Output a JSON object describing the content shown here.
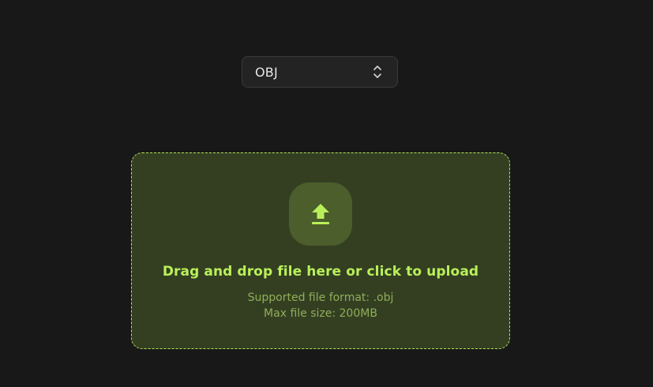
{
  "format_select": {
    "selected": "OBJ",
    "icon": "chevron-up-down-icon"
  },
  "dropzone": {
    "icon": "upload-icon",
    "title": "Drag and drop file here or click to upload",
    "supported_format": "Supported file format: .obj",
    "max_size": "Max file size: 200MB"
  },
  "colors": {
    "background": "#181818",
    "accent": "#b9f05a",
    "dropzone_bg": "#343f22",
    "badge_bg": "#4b5e2b",
    "muted_text": "#8fae58"
  }
}
